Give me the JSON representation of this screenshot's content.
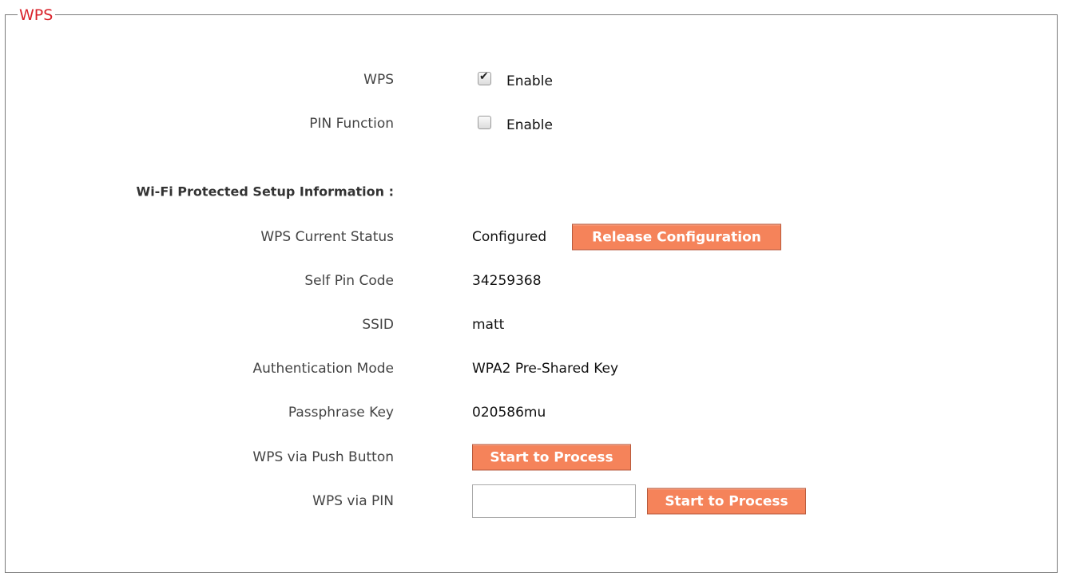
{
  "section": {
    "title": "WPS"
  },
  "wps": {
    "label": "WPS",
    "enable_label": "Enable",
    "checked": true
  },
  "pin_function": {
    "label": "PIN Function",
    "enable_label": "Enable",
    "checked": false
  },
  "info": {
    "heading": "Wi-Fi Protected Setup Information   :"
  },
  "status": {
    "label": "WPS Current Status",
    "value": "Configured",
    "release_button": "Release Configuration"
  },
  "self_pin": {
    "label": "Self Pin Code",
    "value": "34259368"
  },
  "ssid": {
    "label": "SSID",
    "value": "matt"
  },
  "auth_mode": {
    "label": "Authentication Mode",
    "value": "WPA2 Pre-Shared Key"
  },
  "passphrase": {
    "label": "Passphrase Key",
    "value": "020586mu"
  },
  "push_button": {
    "label": "WPS via Push Button",
    "button": "Start to Process"
  },
  "via_pin": {
    "label": "WPS via PIN",
    "input_value": "",
    "button": "Start to Process"
  },
  "colors": {
    "accent_button": "#f5835a",
    "legend_text": "#d9222a"
  }
}
